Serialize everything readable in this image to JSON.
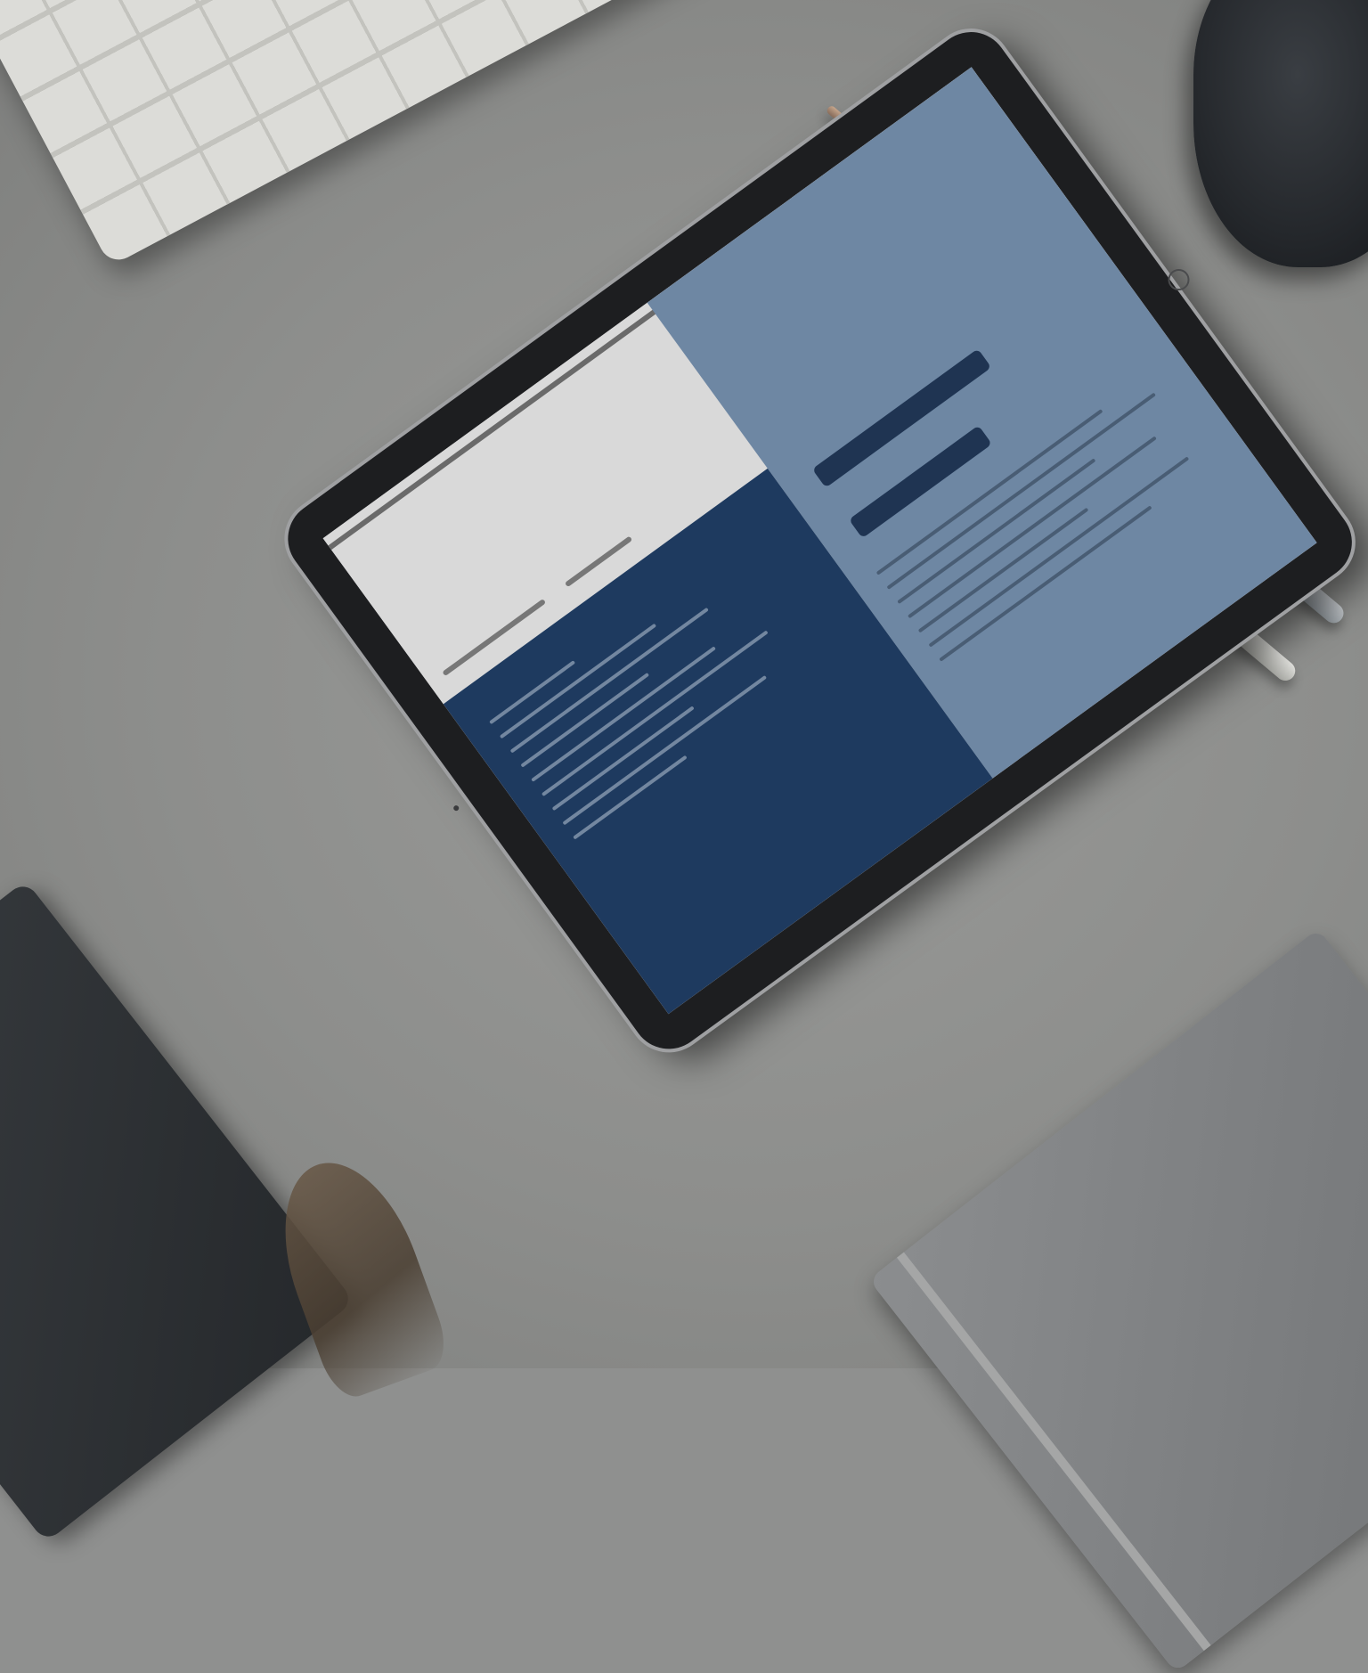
{
  "scene": {
    "description_items": [
      "keyboard",
      "tablet",
      "pens",
      "mug",
      "notebooks"
    ]
  },
  "colors": {
    "desk": "#8f908f",
    "tablet_bezel": "#1d1e20",
    "screen_left_pane": "#1e3a5f",
    "screen_right_pane": "#6e87a3",
    "screen_top": "#d9d9d9"
  },
  "icons": {
    "gear": "gear-icon"
  }
}
